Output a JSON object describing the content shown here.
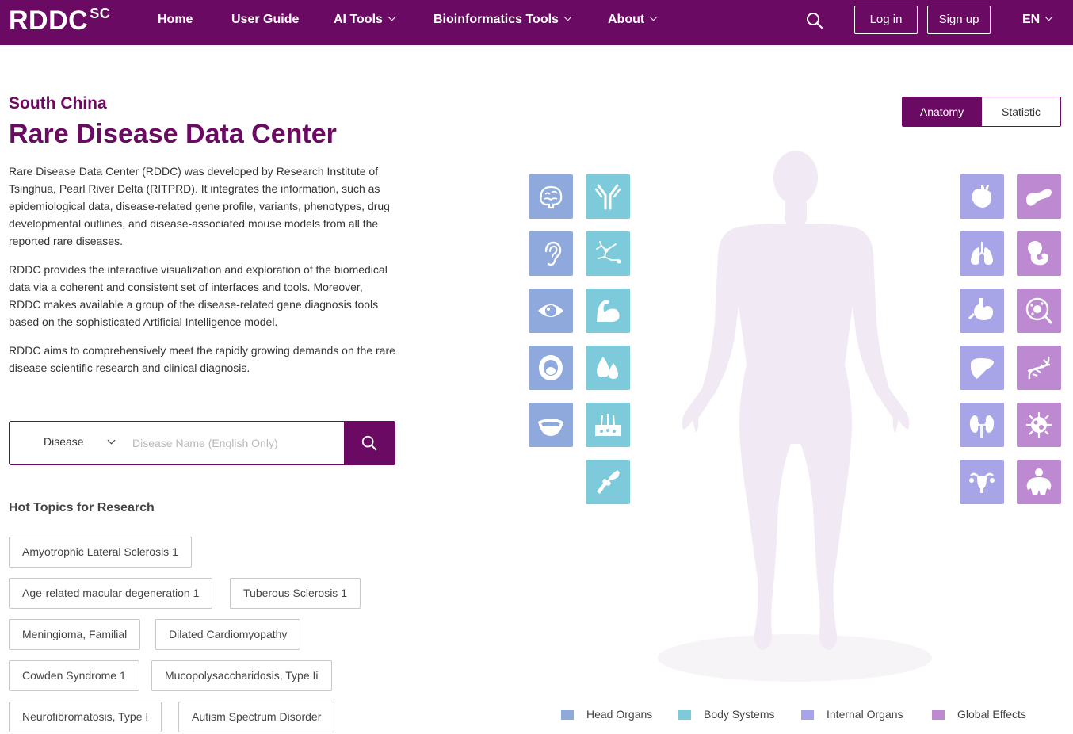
{
  "nav": {
    "logo": "RDDC",
    "logo_sup": "SC",
    "items": [
      "Home",
      "User Guide",
      "AI Tools",
      "Bioinformatics Tools",
      "About"
    ],
    "login": "Log in",
    "signup": "Sign up",
    "lang": "EN"
  },
  "hero": {
    "subtitle": "South China",
    "title": "Rare Disease Data Center",
    "paragraphs": [
      "Rare Disease Data Center (RDDC) was developed by Research Institute of Tsinghua, Pearl River Delta (RITPRD). It integrates the information, such as epidemiological data, disease-related gene profile, variants, phenotypes, drug developmental outlines, and disease-associated mouse models from all the reported rare diseases.",
      "RDDC provides the interactive visualization and exploration of the biomedical data via a coherent and consistent set of interfaces and tools. Moreover, RDDC makes available a group of the disease-related gene diagnosis tools based on the sophisticated Artificial Intelligence model.",
      "RDDC aims to comprehensively meet the rapidly growing demands on the rare disease scientific research and clinical diagnosis."
    ]
  },
  "search": {
    "type": "Disease",
    "placeholder": "Disease Name (English Only)",
    "value": ""
  },
  "hot_topics": {
    "title": "Hot Topics for Research",
    "tags": [
      "Amyotrophic Lateral Sclerosis 1",
      "Age-related macular degeneration 1",
      "Tuberous Sclerosis 1",
      "Meningioma, Familial",
      "Dilated Cardiomyopathy",
      "Cowden Syndrome 1",
      "Mucopolysaccharidosis, Type Ii",
      "Neurofibromatosis, Type I",
      "Autism Spectrum Disorder"
    ]
  },
  "view_toggle": {
    "anatomy": "Anatomy",
    "statistic": "Statistic",
    "active": "anatomy"
  },
  "colors": {
    "brand": "#6b0a62",
    "head_organs": "#8fa9dc",
    "body_systems": "#7ccada",
    "internal_organs": "#a7a4e8",
    "global_effects": "#bd8ad1"
  },
  "legend": [
    "Head Organs",
    "Body Systems",
    "Internal Organs",
    "Global Effects"
  ],
  "icons": {
    "head": [
      "brain-icon",
      "ear-icon",
      "eye-icon",
      "mouth-icon",
      "teeth-icon"
    ],
    "body": [
      "antibody-icon",
      "nerve-icon",
      "muscle-icon",
      "blood-drop-icon",
      "skin-icon",
      "bone-joint-icon"
    ],
    "internal": [
      "heart-icon",
      "lung-icon",
      "stomach-icon",
      "liver-icon",
      "kidney-icon",
      "uterus-icon"
    ],
    "global": [
      "pancreas-icon",
      "fetus-icon",
      "cell-icon",
      "dna-icon",
      "virus-icon",
      "obesity-icon"
    ]
  }
}
